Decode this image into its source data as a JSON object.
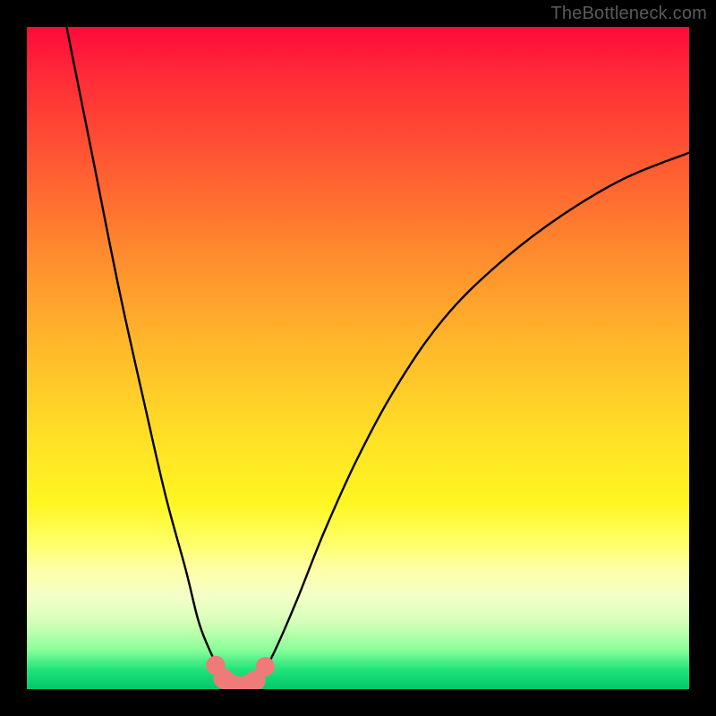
{
  "watermark": "TheBottleneck.com",
  "chart_data": {
    "type": "line",
    "title": "",
    "xlabel": "",
    "ylabel": "",
    "xlim": [
      0,
      100
    ],
    "ylim": [
      0,
      100
    ],
    "background_gradient": {
      "top": "#ff0a3a",
      "bottom": "#00c86a",
      "stops": [
        "red",
        "orange",
        "yellow",
        "green"
      ]
    },
    "series": [
      {
        "name": "left-branch",
        "x": [
          6,
          10,
          14,
          18,
          21,
          24,
          26,
          28,
          29.5,
          30.5
        ],
        "y": [
          100,
          80,
          60,
          42,
          29,
          18,
          10,
          5,
          2,
          1
        ]
      },
      {
        "name": "right-branch",
        "x": [
          34.5,
          36,
          38,
          41,
          45,
          50,
          56,
          63,
          71,
          80,
          90,
          100
        ],
        "y": [
          1,
          3,
          7,
          14,
          24,
          35,
          46,
          56,
          64,
          71,
          77,
          81
        ]
      },
      {
        "name": "valley-floor",
        "x": [
          30.5,
          31.5,
          32.5,
          33.5,
          34.5
        ],
        "y": [
          1,
          0.4,
          0.3,
          0.4,
          1
        ]
      }
    ],
    "markers": {
      "name": "valley-markers",
      "color": "#ef7b78",
      "points": [
        {
          "x": 28.5,
          "y": 3.6,
          "r": 0.9
        },
        {
          "x": 29.7,
          "y": 1.6,
          "r": 1.0
        },
        {
          "x": 30.9,
          "y": 0.6,
          "r": 1.1
        },
        {
          "x": 32.1,
          "y": 0.3,
          "r": 1.1
        },
        {
          "x": 33.3,
          "y": 0.5,
          "r": 1.1
        },
        {
          "x": 34.5,
          "y": 1.3,
          "r": 1.0
        },
        {
          "x": 36.0,
          "y": 3.4,
          "r": 0.9
        }
      ]
    }
  }
}
